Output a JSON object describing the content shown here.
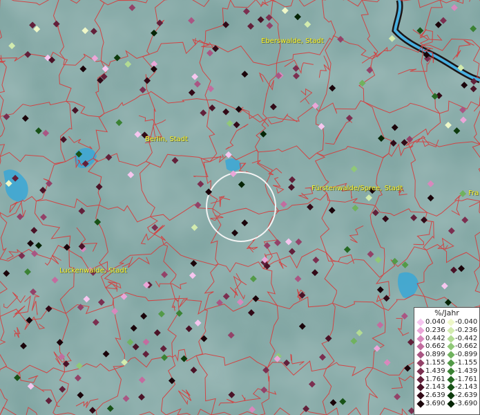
{
  "map": {
    "labels": [
      {
        "text": "Eberswalde, Stadt"
      },
      {
        "text": "Berlin, Stadt"
      },
      {
        "text": "Fürstenwalde/Spree, Stadt"
      },
      {
        "text": "Fra"
      },
      {
        "text": "Luckenwalde, Stadt"
      }
    ],
    "legend": {
      "title": "%/Jahr",
      "positive": [
        {
          "value": "0.040",
          "color": "#f6c6ef"
        },
        {
          "value": "0.236",
          "color": "#eaa6d8"
        },
        {
          "value": "0.442",
          "color": "#d888bd"
        },
        {
          "value": "0.662",
          "color": "#c26d9f"
        },
        {
          "value": "0.899",
          "color": "#a95683"
        },
        {
          "value": "1.155",
          "color": "#934268"
        },
        {
          "value": "1.439",
          "color": "#7b2f50"
        },
        {
          "value": "1.761",
          "color": "#62203a"
        },
        {
          "value": "2.143",
          "color": "#4a1327"
        },
        {
          "value": "2.639",
          "color": "#320a17"
        },
        {
          "value": "3.690",
          "color": "#1a040a"
        }
      ],
      "negative": [
        {
          "value": "-0.040",
          "color": "#eef7c8"
        },
        {
          "value": "-0.236",
          "color": "#d2ebae"
        },
        {
          "value": "-0.442",
          "color": "#b2db93"
        },
        {
          "value": "-0.662",
          "color": "#90c878"
        },
        {
          "value": "-0.899",
          "color": "#70b25f"
        },
        {
          "value": "-1.155",
          "color": "#539a48"
        },
        {
          "value": "-1.439",
          "color": "#3b8234"
        },
        {
          "value": "-1.761",
          "color": "#276a24"
        },
        {
          "value": "-2.143",
          "color": "#185217"
        },
        {
          "value": "-2.639",
          "color": "#0d3b0d"
        },
        {
          "value": "-3.690",
          "color": "#052405"
        }
      ]
    }
  }
}
